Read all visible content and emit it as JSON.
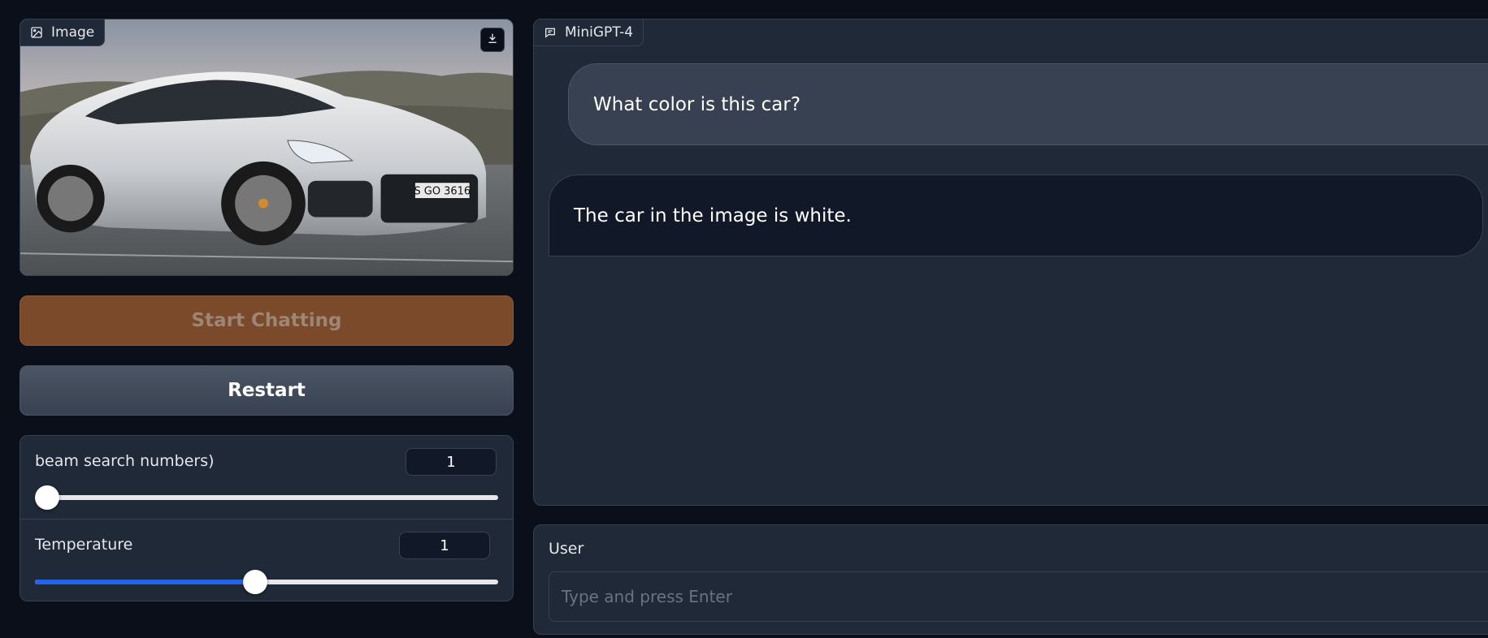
{
  "image_block": {
    "label": "Image",
    "icon": "image-icon",
    "download_icon": "download-icon",
    "plate_text": "S GO 3616"
  },
  "buttons": {
    "start_label": "Start Chatting",
    "restart_label": "Restart"
  },
  "sliders": [
    {
      "label": "beam search numbers)",
      "value": "1",
      "fraction": 0.0
    },
    {
      "label": "Temperature",
      "value": "1",
      "fraction": 0.475
    }
  ],
  "chat": {
    "label": "MiniGPT-4",
    "icon": "chat-icon",
    "messages": [
      {
        "role": "user",
        "text": "What color is this car?"
      },
      {
        "role": "bot",
        "text": "The car in the image is white."
      }
    ]
  },
  "input": {
    "label": "User",
    "placeholder": "Type and press Enter"
  },
  "colors": {
    "accent_blue": "#2563eb",
    "start_button": "#7a4a2a",
    "background": "#0b0f19",
    "panel": "#1f2937"
  }
}
